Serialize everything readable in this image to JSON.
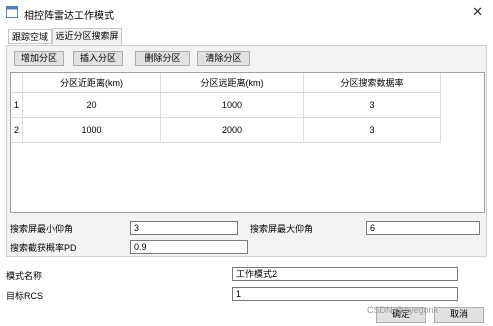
{
  "window": {
    "title": "相控阵雷达工作模式",
    "close_glyph": "✕"
  },
  "tabs": [
    {
      "label": "跟踪空域",
      "active": false
    },
    {
      "label": "远近分区搜索屏",
      "active": true
    }
  ],
  "toolbar": {
    "add": "增加分区",
    "insert": "插入分区",
    "delete": "删除分区",
    "clear": "清除分区"
  },
  "table": {
    "columns": [
      "分区近距离(km)",
      "分区远距离(km)",
      "分区搜索数据率"
    ],
    "rows": [
      {
        "index": "1",
        "cells": [
          "20",
          "1000",
          "3"
        ]
      },
      {
        "index": "2",
        "cells": [
          "1000",
          "2000",
          "3"
        ]
      }
    ]
  },
  "params": {
    "min_elev_label": "搜索屏最小仰角",
    "min_elev_value": "3",
    "max_elev_label": "搜索屏最大仰角",
    "max_elev_value": "6",
    "pd_label": "搜索截获概率PD",
    "pd_value": "0.9"
  },
  "mode": {
    "name_label": "模式名称",
    "name_value": "工作模式2",
    "rcs_label": "目标RCS",
    "rcs_value": "1"
  },
  "footer": {
    "ok": "确定",
    "cancel": "取消",
    "watermark": "CSDN @eyegonk"
  }
}
